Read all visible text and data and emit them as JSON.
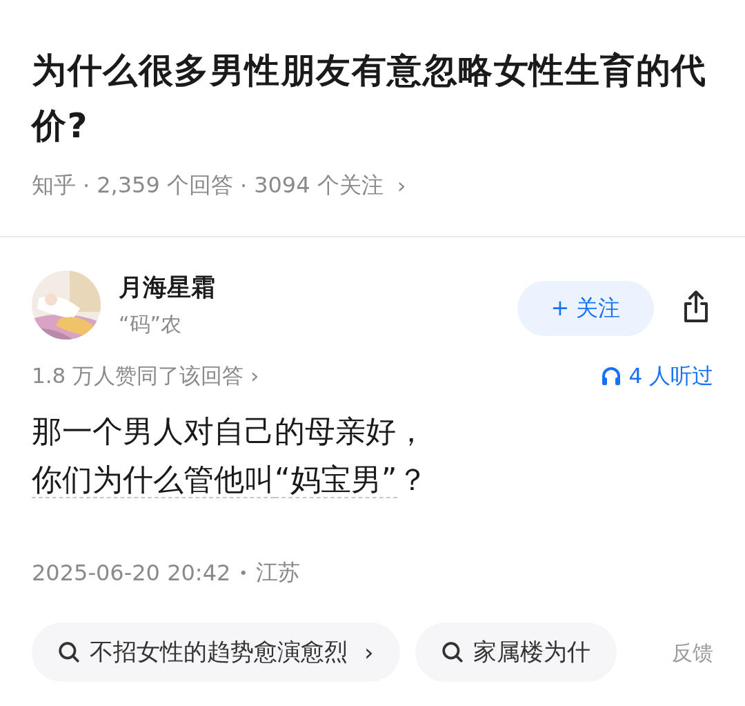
{
  "question": {
    "title": "为什么很多男性朋友有意忽略女性生育的代价?",
    "source": "知乎",
    "answers": "2,359 个回答",
    "followers": "3094 个关注",
    "chevron": "›",
    "separator": "·"
  },
  "author": {
    "name": "月海星霜",
    "bio": "“码”农",
    "follow_label": "+ 关注",
    "followed": false
  },
  "stats": {
    "approvals": "1.8 万人赞同了该回答 ›",
    "listeners": "4 人听过"
  },
  "answer": {
    "parts": [
      {
        "kind": "plain",
        "text": "那一个男人对自己的母亲好，"
      },
      {
        "kind": "link",
        "text": "你们为什么管他叫"
      },
      {
        "kind": "link",
        "text": "“妈宝男”"
      },
      {
        "kind": "plain",
        "text": "？"
      }
    ]
  },
  "meta": {
    "time": "2025-06-20 20:42",
    "separator": "•",
    "location": "江苏"
  },
  "related_searches": [
    {
      "text": "不招女性的趋势愈演愈烈",
      "chevron": "›"
    },
    {
      "text": "家属楼为什"
    }
  ],
  "feedback": "反馈"
}
